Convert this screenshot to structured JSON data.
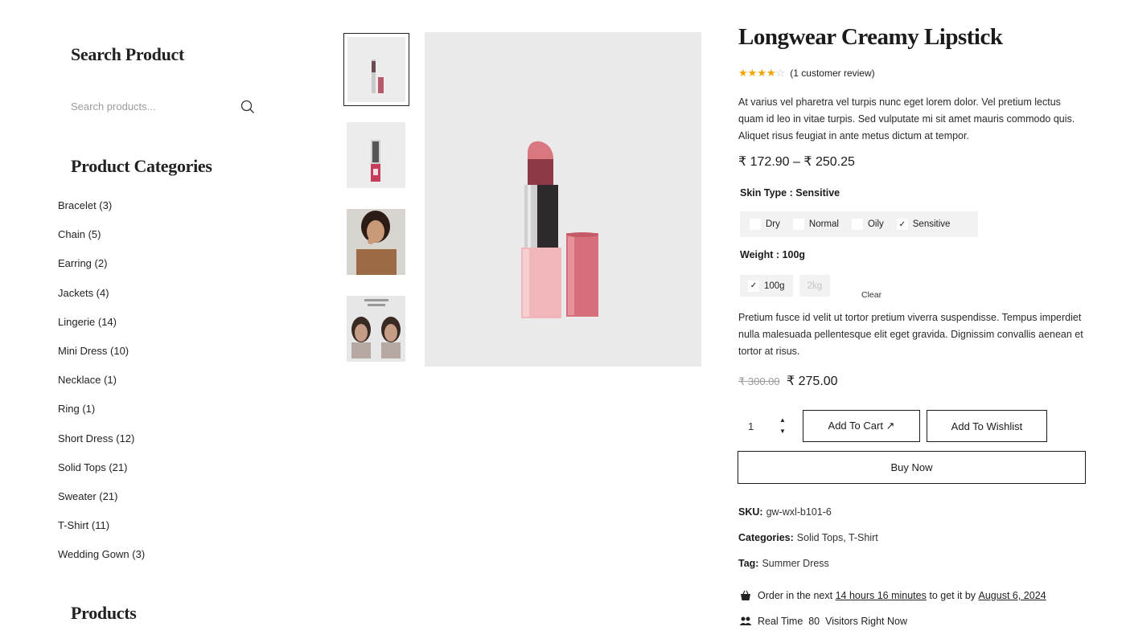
{
  "sidebar": {
    "search_title": "Search Product",
    "search_placeholder": "Search products...",
    "categories_title": "Product Categories",
    "categories": [
      "Bracelet (3)",
      "Chain (5)",
      "Earring (2)",
      "Jackets (4)",
      "Lingerie (14)",
      "Mini Dress (10)",
      "Necklace (1)",
      "Ring (1)",
      "Short Dress (12)",
      "Solid Tops (21)",
      "Sweater (21)",
      "T-Shirt (11)",
      "Wedding Gown (3)"
    ],
    "products_title": "Products"
  },
  "gallery": {
    "thumbnails": [
      "lipstick-front",
      "lipstick-open",
      "model-applying-lipstick",
      "before-after-comparison"
    ],
    "main_image": "lipstick-with-cap"
  },
  "product": {
    "title": "Longwear Creamy Lipstick",
    "rating": 4,
    "rating_max": 5,
    "review_text": "(1 customer review)",
    "description": "At varius vel pharetra vel turpis nunc eget lorem dolor. Vel pretium lectus quam id leo in vitae turpis. Sed vulputate mi sit amet mauris commodo quis. Aliquet risus feugiat in ante metus dictum at tempor.",
    "price_range": "₹ 172.90 – ₹ 250.25",
    "skin_type_label": "Skin Type : Sensitive",
    "skin_options": [
      {
        "label": "Dry",
        "checked": false
      },
      {
        "label": "Normal",
        "checked": false
      },
      {
        "label": "Oily",
        "checked": false
      },
      {
        "label": "Sensitive",
        "checked": true
      }
    ],
    "weight_label": "Weight : 100g",
    "weight_options": [
      {
        "label": "100g",
        "checked": true
      },
      {
        "label": "2kg",
        "checked": false
      }
    ],
    "clear_label": "Clear",
    "description2": "Pretium fusce id velit ut tortor pretium viverra suspendisse. Tempus imperdiet nulla malesuada pellentesque elit eget gravida. Dignissim convallis aenean et tortor at risus.",
    "old_price": "₹ 300.00",
    "new_price": "₹ 275.00",
    "quantity": "1",
    "add_to_cart": "Add To Cart ↗",
    "add_to_wishlist": "Add To Wishlist",
    "buy_now": "Buy Now",
    "sku_label": "SKU:",
    "sku_value": "gw-wxl-b101-6",
    "categories_label": "Categories:",
    "categories_value": "Solid Tops, T-Shirt",
    "tag_label": "Tag:",
    "tag_value": "Summer Dress",
    "order_prefix": "Order in the next",
    "order_time": "14 hours 16 minutes",
    "order_mid": "to get it by",
    "order_date": "August 6, 2024",
    "visitors_prefix": "Real Time",
    "visitors_count": "80",
    "visitors_suffix": "Visitors Right Now"
  },
  "colors": {
    "star": "#f0a500",
    "text": "#1b1b1b",
    "muted": "#9b9b9b",
    "image_bg": "#eaeaea",
    "lipstick": "#d9787f"
  }
}
